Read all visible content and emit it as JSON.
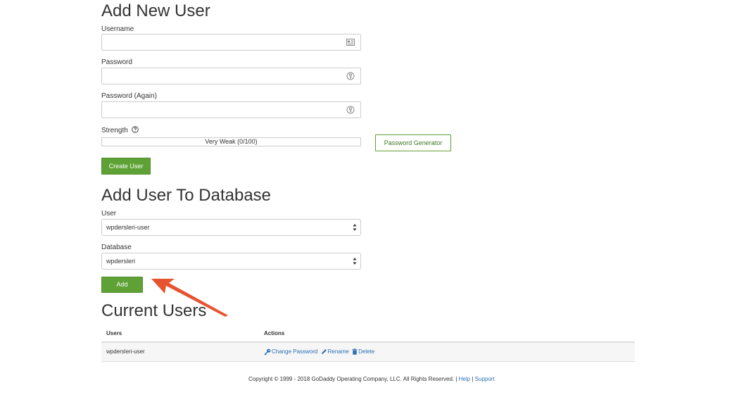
{
  "add_user": {
    "title": "Add New User",
    "username_label": "Username",
    "username_value": "",
    "password_label": "Password",
    "password_value": "",
    "password_again_label": "Password (Again)",
    "password_again_value": "",
    "strength_label": "Strength",
    "strength_text": "Very Weak (0/100)",
    "strength_value": 0,
    "generator_button": "Password Generator",
    "create_button": "Create User"
  },
  "add_to_db": {
    "title": "Add User To Database",
    "user_label": "User",
    "user_selected": "wpdersleri-user",
    "database_label": "Database",
    "database_selected": "wpdersleri",
    "add_button": "Add"
  },
  "current_users": {
    "title": "Current Users",
    "columns": [
      "Users",
      "Actions"
    ],
    "rows": [
      {
        "user": "wpdersleri-user",
        "actions": [
          "Change Password",
          "Rename",
          "Delete"
        ]
      }
    ]
  },
  "footer": {
    "copyright": "Copyright © 1999 - 2018 GoDaddy Operating Company, LLC. All Rights Reserved. |",
    "help": "Help",
    "separator": "|",
    "support": "Support"
  },
  "colors": {
    "accent_green": "#5ea235",
    "link_blue": "#2a6fb4",
    "annotation_arrow": "#e8532f"
  },
  "icons": {
    "username_field": "contact-card-icon",
    "password_field": "key-icon",
    "strength_help": "question-circle-icon",
    "change_password": "key-icon",
    "rename": "pencil-icon",
    "delete": "trash-icon",
    "select_caret": "up-down-caret-icon",
    "annotation": "arrow-annotation"
  }
}
